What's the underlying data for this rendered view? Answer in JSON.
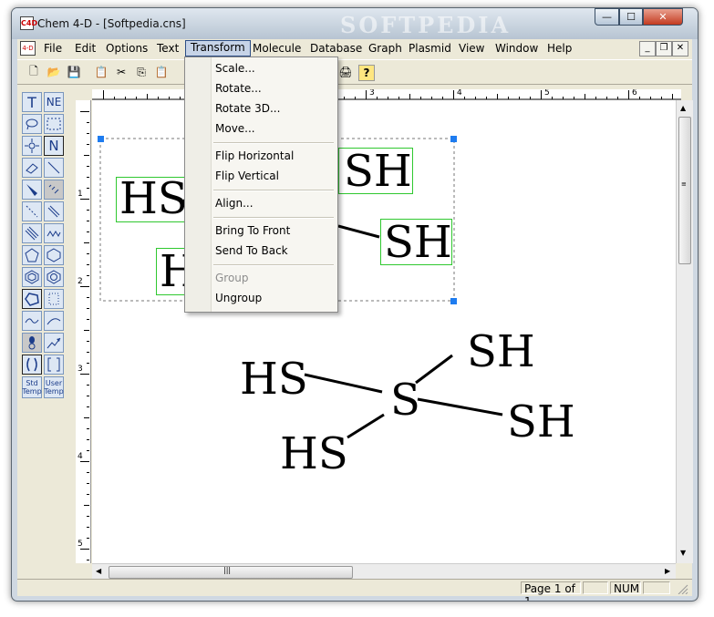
{
  "window": {
    "title": "Chem 4-D - [Softpedia.cns]",
    "watermark": "SOFTPEDIA",
    "app_icon_label": "C4D",
    "minimize_glyph": "—",
    "maximize_glyph": "☐",
    "close_glyph": "✕"
  },
  "menubar": {
    "doc_icon_label": "4-D",
    "items": [
      "File",
      "Edit",
      "Options",
      "Text",
      "Transform",
      "Molecule",
      "Database",
      "Graph",
      "Plasmid",
      "View",
      "Window",
      "Help"
    ],
    "active": "Transform",
    "mdi_min": "_",
    "mdi_restore": "❐",
    "mdi_close": "✕"
  },
  "toolbar": {
    "buttons": [
      "new-file",
      "open-folder",
      "save",
      "paste-special",
      "cut",
      "copy",
      "paste",
      "print",
      "help"
    ],
    "glyphs": {
      "new": "🗋",
      "open": "📂",
      "save": "💾",
      "special": "📋",
      "cut": "✂",
      "copy": "⎘",
      "paste": "📋",
      "print": "🖨",
      "help": "?"
    }
  },
  "tool_palette": {
    "text_tool": "T",
    "ne_tool": "NE",
    "n_tool": "N",
    "std_temp": "Std\nTemp",
    "user_temp": "User\nTemp"
  },
  "transform_menu": {
    "items": [
      {
        "label": "Scale...",
        "enabled": true
      },
      {
        "label": "Rotate...",
        "enabled": true
      },
      {
        "label": "Rotate 3D...",
        "enabled": true
      },
      {
        "label": "Move...",
        "enabled": true
      },
      {
        "label": "Flip Horizontal",
        "enabled": true
      },
      {
        "label": "Flip Vertical",
        "enabled": true
      },
      {
        "label": "Align...",
        "enabled": true
      },
      {
        "label": "Bring To Front",
        "enabled": true
      },
      {
        "label": "Send To Back",
        "enabled": true
      },
      {
        "label": "Group",
        "enabled": false
      },
      {
        "label": "Ungroup",
        "enabled": true
      }
    ]
  },
  "ruler": {
    "h_labels": [
      "1",
      "2",
      "3",
      "4",
      "5",
      "6"
    ],
    "v_labels": [
      "1",
      "2",
      "3",
      "4",
      "5"
    ]
  },
  "molecules": {
    "selected": {
      "hs_left": "HS",
      "sh_top": "SH",
      "sh_right": "SH",
      "hs_bottom": "H"
    },
    "lower": {
      "center": "S",
      "hs_left": "HS",
      "sh_top": "SH",
      "sh_right": "SH",
      "hs_bottom": "HS"
    }
  },
  "statusbar": {
    "page": "Page 1 of 1",
    "num": "NUM"
  },
  "scroll": {
    "grip": "|||"
  }
}
